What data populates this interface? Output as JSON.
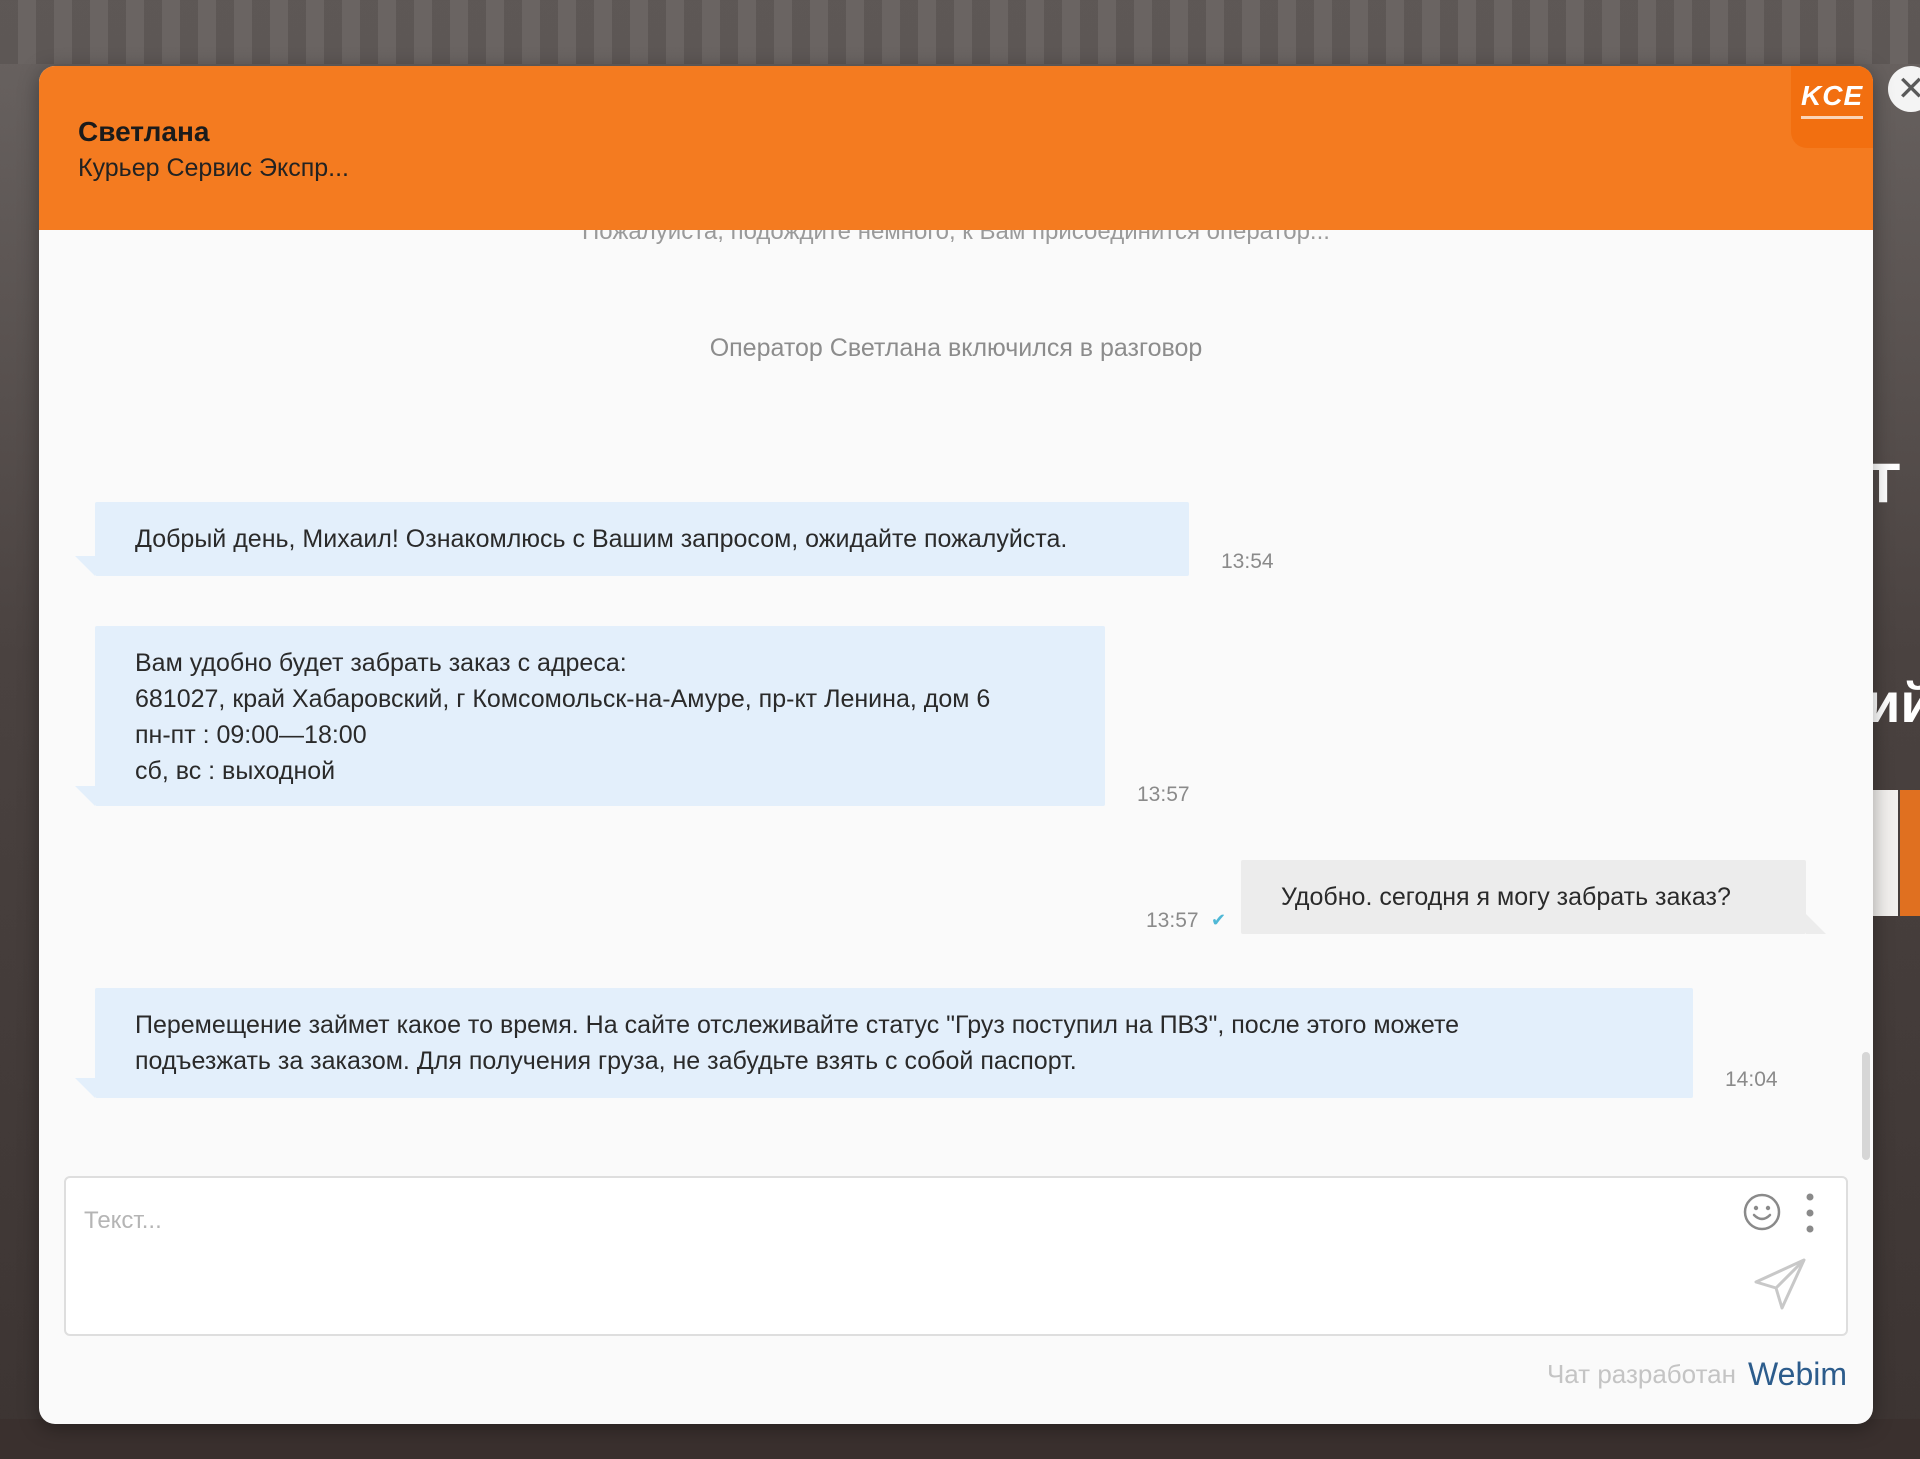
{
  "header": {
    "operator_name": "Светлана",
    "company": "Курьер Сервис Экспр...",
    "logo_text": "KCE"
  },
  "background": {
    "text_1": "Т",
    "text_2": "ий"
  },
  "chat": {
    "system_cut": "Пожалуйста, подождите немного, к Вам присоединится оператор...",
    "system_joined": "Оператор Светлана включился в разговор",
    "messages": [
      {
        "direction": "in",
        "lines": [
          "Добрый день, Михаил! Ознакомлюсь с Вашим запросом, ожидайте пожалуйста."
        ],
        "time": "13:54"
      },
      {
        "direction": "in",
        "lines": [
          "Вам удобно будет забрать заказ с адреса:",
          "681027, край Хабаровский, г Комсомольск-на-Амуре, пр-кт Ленина, дом 6",
          "пн-пт : 09:00—18:00",
          "сб, вс : выходной"
        ],
        "time": "13:57"
      },
      {
        "direction": "out",
        "lines": [
          "Удобно. сегодня я могу забрать заказ?"
        ],
        "time": "13:57",
        "read_mark": "✔"
      },
      {
        "direction": "in",
        "lines": [
          "Перемещение займет какое то время. На сайте отслеживайте статус \"Груз поступил на ПВЗ\", после этого можете",
          "подъезжать за заказом. Для получения груза, не забудьте взять с собой паспорт."
        ],
        "time": "14:04"
      }
    ]
  },
  "composer": {
    "placeholder": "Текст...",
    "value": "",
    "emoji_icon": "smiley-icon",
    "more_icon": "vertical-dots-icon",
    "send_icon": "paper-plane-icon"
  },
  "footer": {
    "credit": "Чат разработан",
    "brand": "Webim"
  },
  "colors": {
    "header_bg": "#f47b20",
    "incoming_bubble": "#e3effb",
    "outgoing_bubble": "#ececec",
    "read_check": "#4fb8d6"
  }
}
